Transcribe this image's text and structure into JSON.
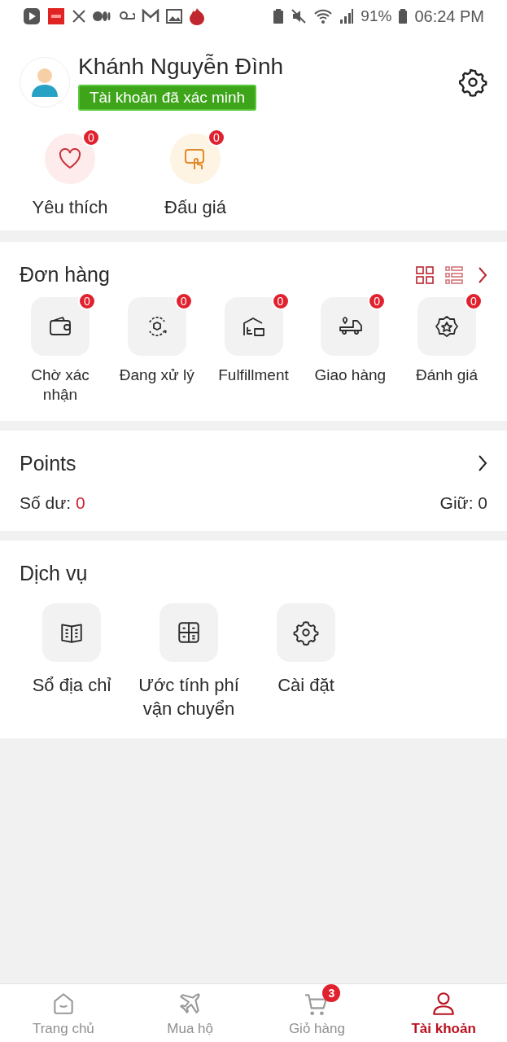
{
  "status_bar": {
    "battery": "91%",
    "time": "06:24 PM"
  },
  "profile": {
    "name": "Khánh Nguyễn Đình",
    "badge": "Tài khoản đã xác minh"
  },
  "shortcuts": [
    {
      "label": "Yêu thích",
      "count": "0"
    },
    {
      "label": "Đấu giá",
      "count": "0"
    }
  ],
  "orders": {
    "title": "Đơn hàng",
    "items": [
      {
        "label": "Chờ xác nhận",
        "count": "0"
      },
      {
        "label": "Đang xử lý",
        "count": "0"
      },
      {
        "label": "Fulfillment",
        "count": "0"
      },
      {
        "label": "Giao hàng",
        "count": "0"
      },
      {
        "label": "Đánh giá",
        "count": "0"
      }
    ]
  },
  "points": {
    "title": "Points",
    "balance_label": "Số dư:",
    "balance": "0",
    "held": "Giữ: 0"
  },
  "services": {
    "title": "Dịch vụ",
    "items": [
      {
        "label": "Sổ địa chỉ"
      },
      {
        "label": "Ước tính phí vận chuyển"
      },
      {
        "label": "Cài đặt"
      }
    ]
  },
  "bottom_nav": [
    {
      "label": "Trang chủ",
      "selected": false
    },
    {
      "label": "Mua hộ",
      "selected": false
    },
    {
      "label": "Giỏ hàng",
      "selected": false,
      "badge": "3"
    },
    {
      "label": "Tài khoản",
      "selected": true
    }
  ]
}
